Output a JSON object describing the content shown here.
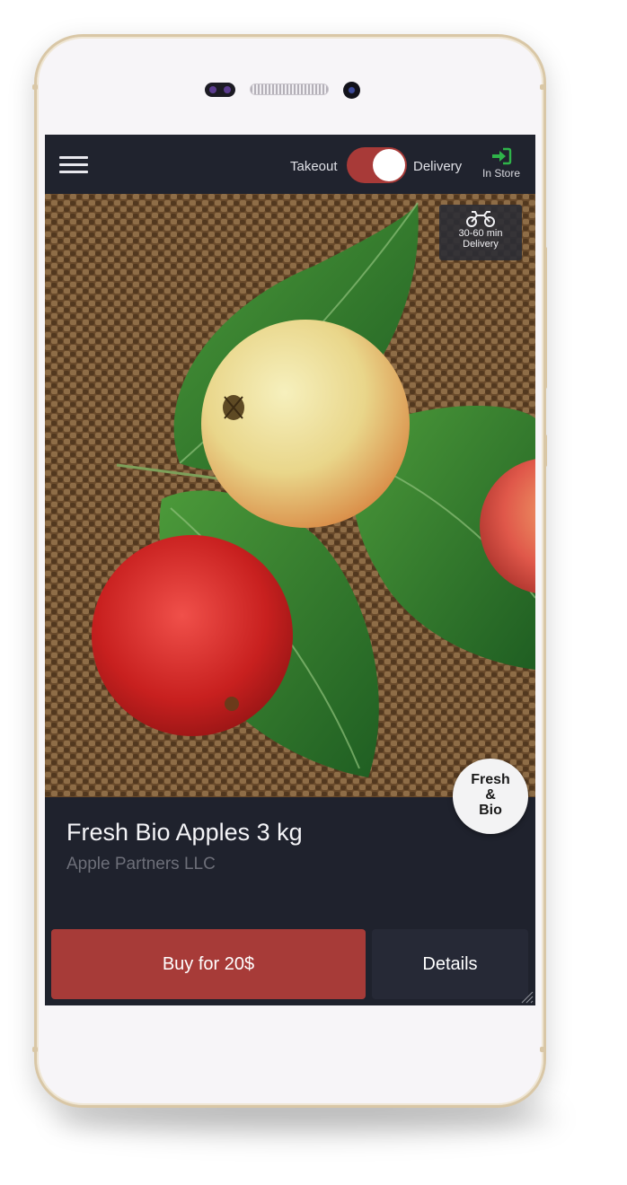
{
  "topbar": {
    "takeout_label": "Takeout",
    "delivery_label": "Delivery",
    "toggle_state": "delivery",
    "instore_label": "In Store"
  },
  "delivery_badge": {
    "time": "30-60 min",
    "label": "Delivery"
  },
  "product": {
    "title": "Fresh Bio Apples 3 kg",
    "vendor": "Apple Partners LLC",
    "badge_lines": [
      "Fresh",
      "&",
      "Bio"
    ]
  },
  "actions": {
    "buy_label": "Buy for 20$",
    "details_label": "Details"
  },
  "icons": {
    "menu": "hamburger-icon",
    "instore": "sign-in-icon",
    "delivery": "motorcycle-icon"
  },
  "colors": {
    "accent": "#a73b38",
    "background": "#1f222d",
    "instore_icon": "#2fb44a"
  }
}
